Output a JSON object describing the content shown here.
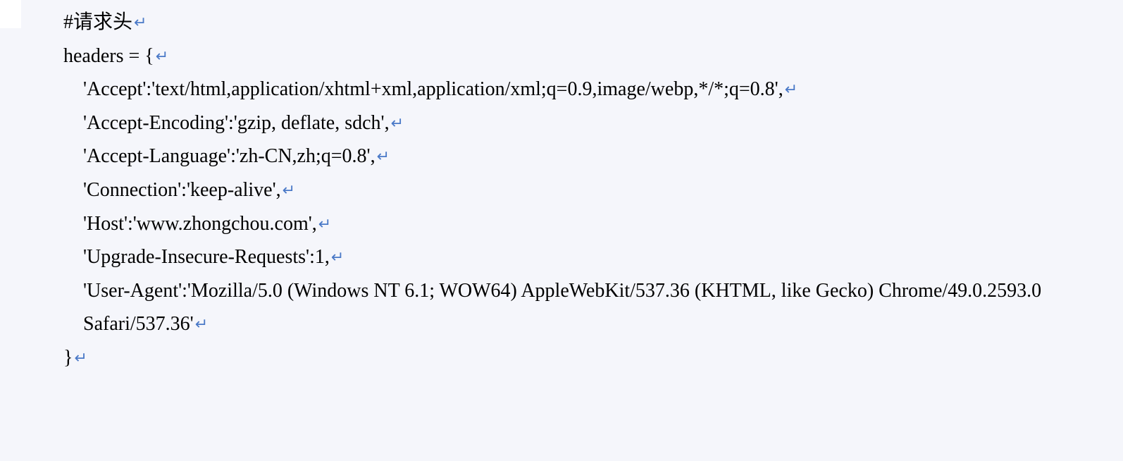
{
  "code": {
    "comment": "#请求头",
    "var_decl": "headers = {",
    "lines": [
      "'Accept':'text/html,application/xhtml+xml,application/xml;q=0.9,image/webp,*/*;q=0.8',",
      "'Accept-Encoding':'gzip, deflate, sdch',",
      "'Accept-Language':'zh-CN,zh;q=0.8',",
      "'Connection':'keep-alive',",
      "'Host':'www.zhongchou.com',",
      "'Upgrade-Insecure-Requests':1,",
      "'User-Agent':'Mozilla/5.0 (Windows NT 6.1; WOW64) AppleWebKit/537.36 (KHTML, like Gecko) Chrome/49.0.2593.0 Safari/537.36'"
    ],
    "close": "}"
  },
  "return_symbol": "↵"
}
